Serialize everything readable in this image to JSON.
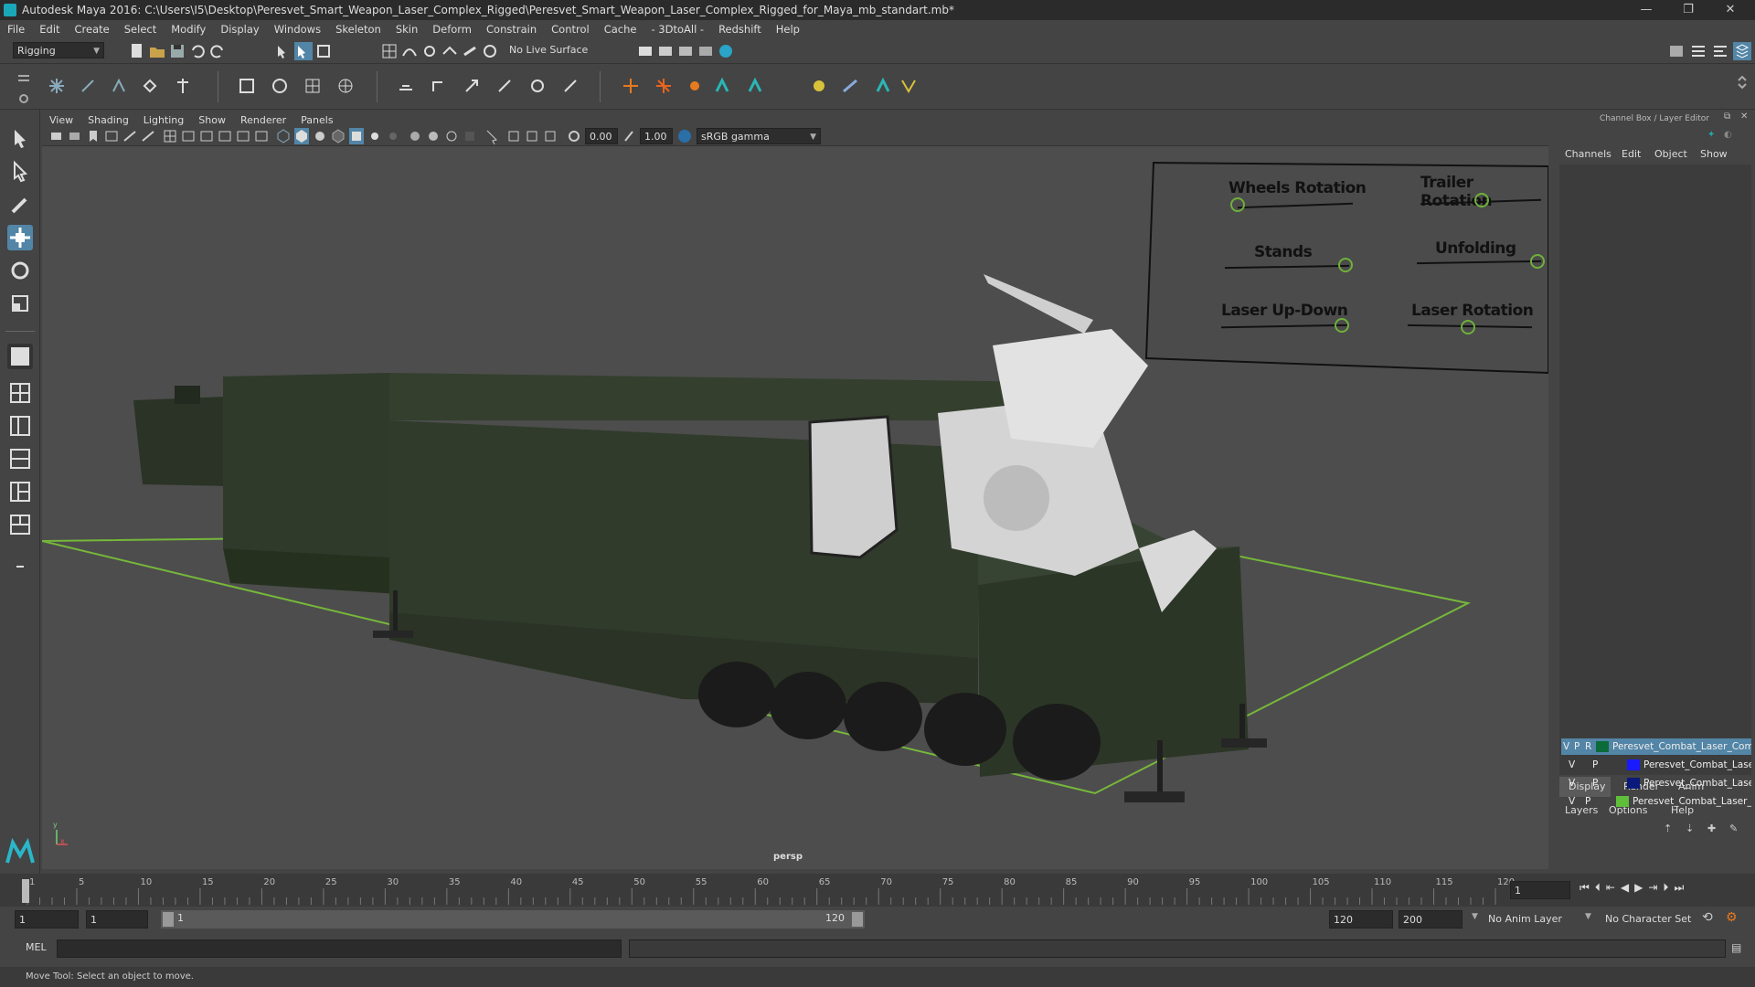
{
  "window": {
    "title": "Autodesk Maya 2016: C:\\Users\\I5\\Desktop\\Peresvet_Smart_Weapon_Laser_Complex_Rigged\\Peresvet_Smart_Weapon_Laser_Complex_Rigged_for_Maya_mb_standart.mb*",
    "minimize": "—",
    "restore": "❐",
    "close": "✕"
  },
  "menu": [
    "File",
    "Edit",
    "Create",
    "Select",
    "Modify",
    "Display",
    "Windows",
    "Skeleton",
    "Skin",
    "Deform",
    "Constrain",
    "Control",
    "Cache",
    "- 3DtoAll -",
    "Redshift",
    "Help"
  ],
  "status": {
    "menuset": "Rigging",
    "live_surface": "No Live Surface"
  },
  "viewport_menu": [
    "View",
    "Shading",
    "Lighting",
    "Show",
    "Renderer",
    "Panels"
  ],
  "viewport_toolbar": {
    "exposure": "0.00",
    "gamma": "1.00",
    "colorspace": "sRGB gamma"
  },
  "viewport": {
    "camera_label": "persp",
    "axis_y": "y",
    "axis_x": "x"
  },
  "rig_controls": {
    "items": [
      {
        "label": "Wheels Rotation",
        "value": 0.0
      },
      {
        "label": "Trailer Rotation",
        "value": 0.5
      },
      {
        "label": "Stands",
        "value": 1.0
      },
      {
        "label": "Unfolding",
        "value": 1.0
      },
      {
        "label": "Laser Up-Down",
        "value": 0.95
      },
      {
        "label": "Laser Rotation",
        "value": 0.5
      }
    ]
  },
  "channel_box": {
    "title": "Channel Box / Layer Editor",
    "tabs": [
      "Channels",
      "Edit",
      "Object",
      "Show"
    ]
  },
  "layer_editor": {
    "tabs": [
      "Display",
      "Render",
      "Anim"
    ],
    "menu": [
      "Layers",
      "Options",
      "Help"
    ],
    "layers": [
      {
        "v": "V",
        "p": "P",
        "r": "R",
        "name": "Peresvet_Combat_Laser_Com",
        "color": "#0b6b3a",
        "selected": true
      },
      {
        "v": "V",
        "p": "P",
        "r": "",
        "name": "Peresvet_Combat_Lase",
        "color": "#1a1aff",
        "selected": false
      },
      {
        "v": "V",
        "p": "P",
        "r": "",
        "name": "Peresvet_Combat_Lase",
        "color": "#0a1a7a",
        "selected": false
      },
      {
        "v": "V",
        "p": "P",
        "r": "",
        "name": "Peresvet_Combat_Laser_C",
        "color": "#5fbf3a",
        "selected": false
      }
    ]
  },
  "timeline": {
    "ticks": [
      "1",
      "5",
      "10",
      "15",
      "20",
      "25",
      "30",
      "35",
      "40",
      "45",
      "50",
      "55",
      "60",
      "65",
      "70",
      "75",
      "80",
      "85",
      "90",
      "95",
      "100",
      "105",
      "110",
      "115",
      "120"
    ],
    "current_frame": "1"
  },
  "range": {
    "start": "1",
    "playback_start": "1",
    "slider_start": "1",
    "slider_end": "120",
    "playback_end": "120",
    "end": "200",
    "anim_layer": "No Anim Layer",
    "character_set": "No Character Set"
  },
  "command_line": {
    "label": "MEL"
  },
  "help_line": "Move Tool: Select an object to move."
}
